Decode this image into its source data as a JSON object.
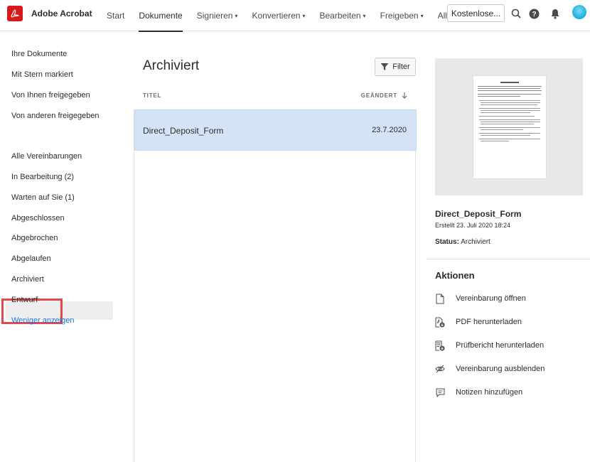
{
  "app": {
    "name": "Adobe Acrobat",
    "brand_color": "#d7191a"
  },
  "nav": {
    "items": [
      {
        "label": "Start",
        "dropdown": false,
        "active": false
      },
      {
        "label": "Dokumente",
        "dropdown": false,
        "active": true
      },
      {
        "label": "Signieren",
        "dropdown": true,
        "active": false
      },
      {
        "label": "Konvertieren",
        "dropdown": true,
        "active": false
      },
      {
        "label": "Bearbeiten",
        "dropdown": true,
        "active": false
      },
      {
        "label": "Freigeben",
        "dropdown": true,
        "active": false
      },
      {
        "label": "Alle Tools",
        "dropdown": false,
        "active": false
      }
    ],
    "trial_button": "Kostenlose...",
    "icons": [
      "search-icon",
      "help-icon",
      "bell-icon",
      "avatar"
    ]
  },
  "sidebar": {
    "group1": [
      "Ihre Dokumente",
      "Mit Stern markiert",
      "Von Ihnen freigegeben",
      "Von anderen freigegeben"
    ],
    "group2": [
      "Alle Vereinbarungen",
      "In Bearbeitung (2)",
      "Warten auf Sie (1)",
      "Abgeschlossen",
      "Abgebrochen",
      "Abgelaufen",
      "Archiviert",
      "Entwurf"
    ],
    "active": "Archiviert",
    "show_less": "Weniger anzeigen"
  },
  "main": {
    "title": "Archiviert",
    "filter_label": "Filter",
    "columns": {
      "title": "TITEL",
      "modified": "GEÄNDERT"
    },
    "rows": [
      {
        "title": "Direct_Deposit_Form",
        "date": "23.7.2020",
        "selected": true
      }
    ]
  },
  "detail": {
    "name": "Direct_Deposit_Form",
    "created": "Erstellt 23. Juli 2020 18:24",
    "status_label": "Status:",
    "status_value": "Archiviert",
    "actions_title": "Aktionen",
    "actions": [
      {
        "label": "Vereinbarung öffnen",
        "icon": "document-icon"
      },
      {
        "label": "PDF herunterladen",
        "icon": "pdf-download-icon"
      },
      {
        "label": "Prüfbericht herunterladen",
        "icon": "report-download-icon"
      },
      {
        "label": "Vereinbarung ausblenden",
        "icon": "eye-hidden-icon"
      },
      {
        "label": "Notizen hinzufügen",
        "icon": "comment-icon"
      }
    ]
  },
  "colors": {
    "selected_row": "#d4e3f7",
    "link": "#1473e6",
    "highlight": "#e34850"
  }
}
